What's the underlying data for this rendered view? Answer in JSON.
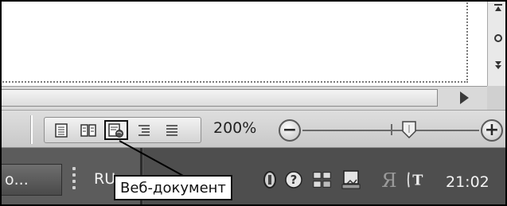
{
  "status_bar": {
    "zoom_percent": "200%",
    "zoom_out_symbol": "−",
    "zoom_in_symbol": "+",
    "zoom_level": 200,
    "view_buttons": [
      {
        "name": "page-layout-view-button",
        "icon": "page-layout-icon",
        "active": false
      },
      {
        "name": "reading-view-button",
        "icon": "open-book-icon",
        "active": false
      },
      {
        "name": "web-document-view-button",
        "icon": "web-document-icon",
        "active": true
      },
      {
        "name": "outline-view-button",
        "icon": "outline-icon",
        "active": false
      },
      {
        "name": "draft-view-button",
        "icon": "draft-icon",
        "active": false
      }
    ]
  },
  "tooltip": {
    "text": "Веб-документ"
  },
  "taskbar": {
    "task_button_label": "о...",
    "language": "RU",
    "clock": "21:02",
    "tray_icons": [
      "speaker-icon",
      "help-icon",
      "network-icon",
      "presentation-icon",
      "yandex-icon",
      "text-input-icon"
    ]
  },
  "scrollbar_vertical": {
    "icons": [
      "scroll-up-icon",
      "browse-object-icon",
      "next-page-icon"
    ]
  }
}
